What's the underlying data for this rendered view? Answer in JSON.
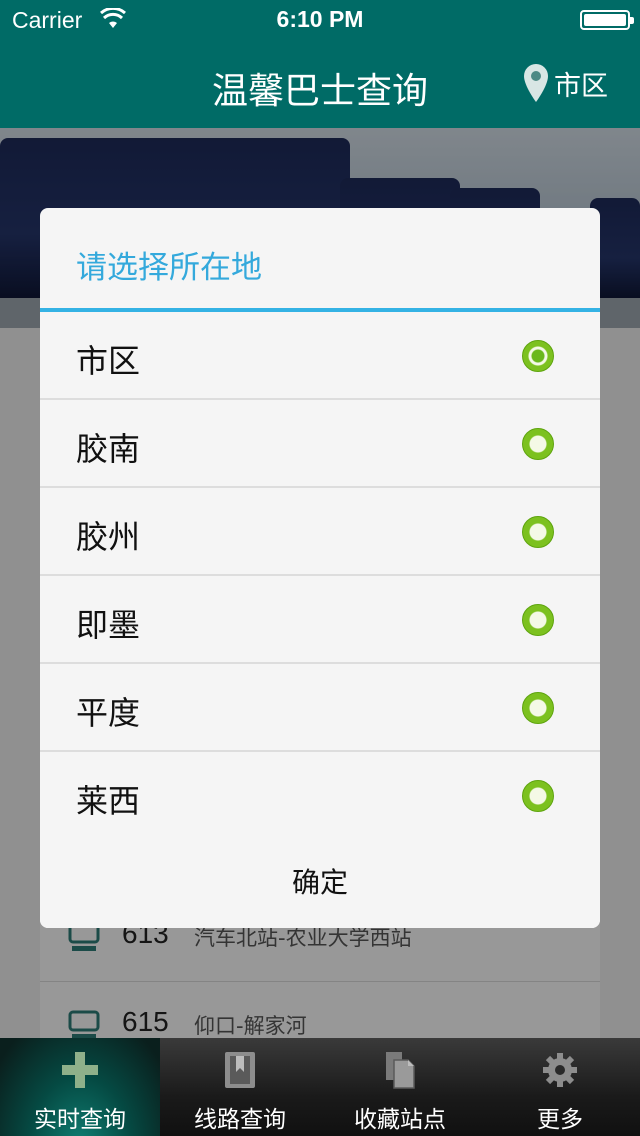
{
  "status_bar": {
    "carrier": "Carrier",
    "time": "6:10 PM"
  },
  "nav": {
    "title": "温馨巴士查询",
    "city": "市区"
  },
  "routes": [
    {
      "number": "613",
      "desc": "汽车北站-农业大学西站"
    },
    {
      "number": "615",
      "desc": "仰口-解家河"
    }
  ],
  "dialog": {
    "title": "请选择所在地",
    "options": [
      {
        "label": "市区",
        "selected": true
      },
      {
        "label": "胶南",
        "selected": false
      },
      {
        "label": "胶州",
        "selected": false
      },
      {
        "label": "即墨",
        "selected": false
      },
      {
        "label": "平度",
        "selected": false
      },
      {
        "label": "莱西",
        "selected": false
      }
    ],
    "confirm": "确定"
  },
  "tabs": [
    {
      "label": "实时查询",
      "icon": "plus-icon",
      "active": true
    },
    {
      "label": "线路查询",
      "icon": "book-icon",
      "active": false
    },
    {
      "label": "收藏站点",
      "icon": "documents-icon",
      "active": false
    },
    {
      "label": "更多",
      "icon": "gear-icon",
      "active": false
    }
  ],
  "colors": {
    "nav_bg": "#006b66",
    "accent": "#34b2e4",
    "radio": "#7cc11f"
  }
}
